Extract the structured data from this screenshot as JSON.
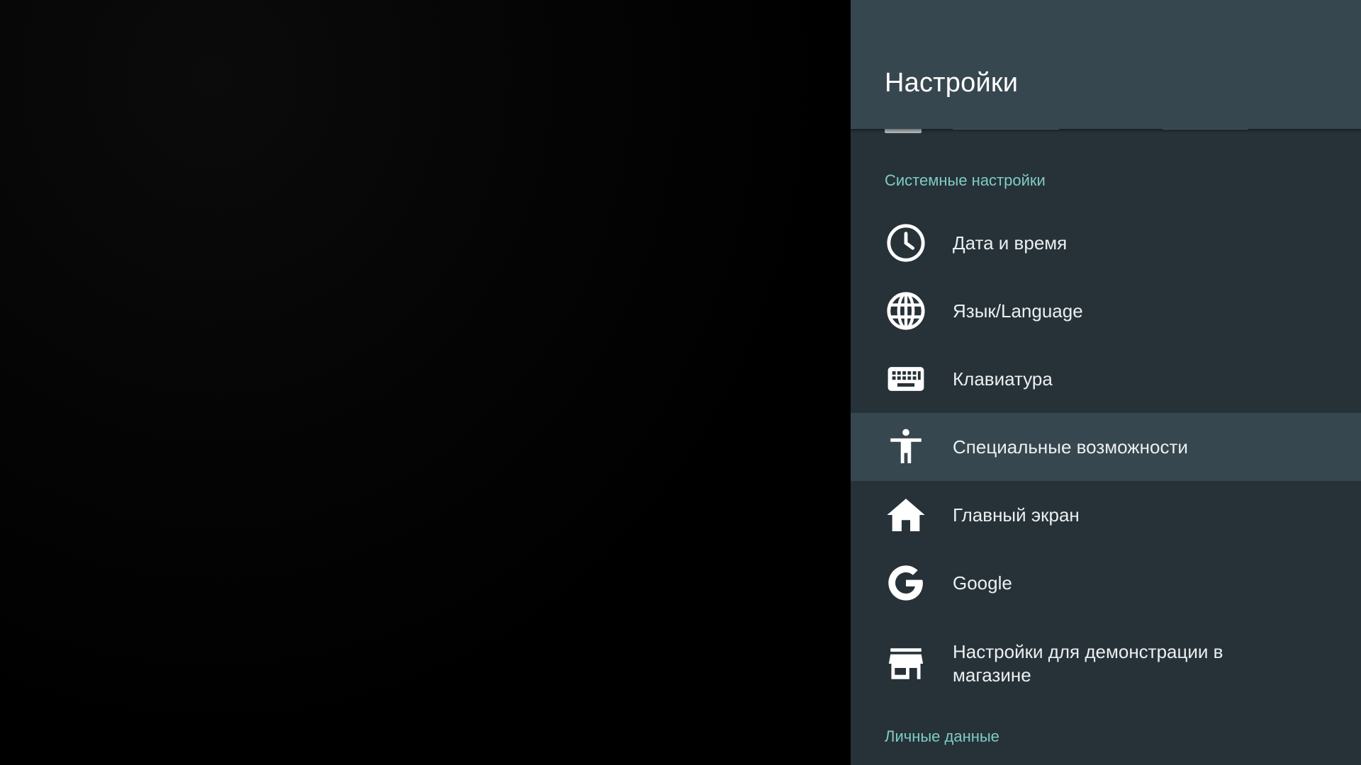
{
  "panel": {
    "title": "Настройки"
  },
  "sections": {
    "system": {
      "header": "Системные настройки",
      "items": [
        {
          "icon": "clock-icon",
          "label": "Дата и время"
        },
        {
          "icon": "globe-icon",
          "label": "Язык/Language"
        },
        {
          "icon": "keyboard-icon",
          "label": "Клавиатура"
        },
        {
          "icon": "accessibility-icon",
          "label": "Специальные возможности",
          "focused": true
        },
        {
          "icon": "home-icon",
          "label": "Главный экран"
        },
        {
          "icon": "google-icon",
          "label": "Google"
        },
        {
          "icon": "store-icon",
          "label": "Настройки для демонстрации в магазине"
        }
      ]
    },
    "personal": {
      "header": "Личные данные"
    }
  },
  "colors": {
    "panel_bg": "#263238",
    "header_bg": "#37474f",
    "focused_bg": "#37474f",
    "accent": "#80cbc4",
    "text": "#eceff1"
  }
}
